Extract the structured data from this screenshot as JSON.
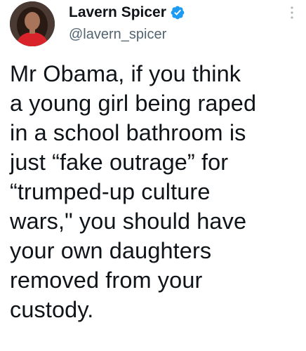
{
  "tweet": {
    "author": {
      "display_name": "Lavern Spicer",
      "handle": "@lavern_spicer",
      "avatar_icon": "avatar-photo",
      "verified_icon": "verified-badge-icon",
      "verified_color": "#1d9bf0"
    },
    "more_icon": "more-options-icon",
    "text": "Mr Obama, if you think\na young girl being raped\nin a school bathroom is\njust “fake outrage” for\n“trumped-up culture\nwars,\" you should have\nyour own daughters\nremoved from your\ncustody."
  }
}
